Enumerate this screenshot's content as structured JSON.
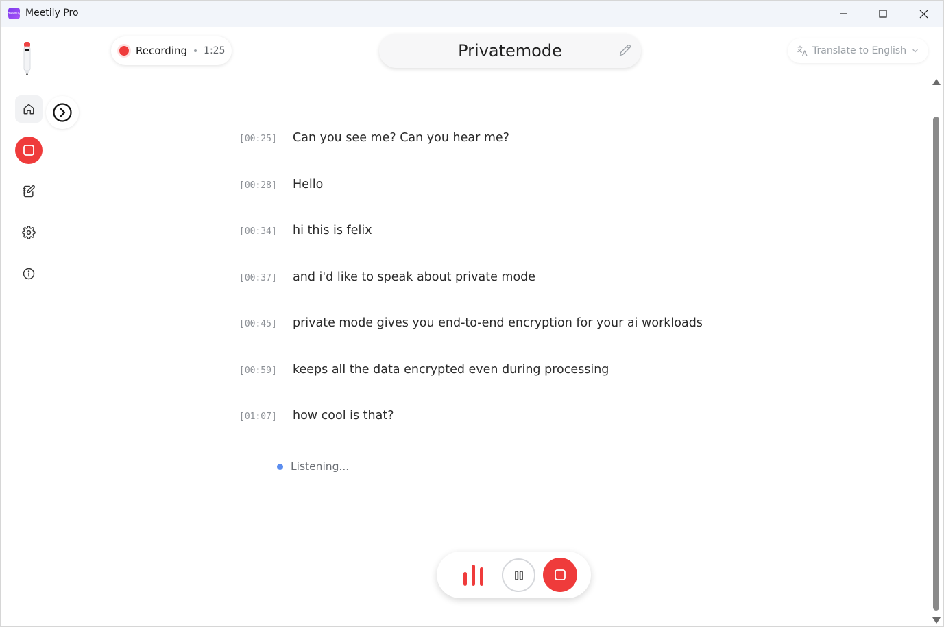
{
  "app": {
    "title": "Meetily Pro",
    "icon_text": "meetily"
  },
  "window_controls": {
    "minimize_icon": "minimize-icon",
    "maximize_icon": "maximize-icon",
    "close_icon": "close-icon"
  },
  "sidebar": {
    "items": [
      {
        "name": "home",
        "icon": "home-icon"
      },
      {
        "name": "record",
        "icon": "stop-square-icon"
      },
      {
        "name": "notes",
        "icon": "notebook-edit-icon"
      },
      {
        "name": "settings",
        "icon": "gear-icon"
      },
      {
        "name": "info",
        "icon": "info-icon"
      }
    ],
    "collapse_icon": "chevron-right-circle-icon"
  },
  "header": {
    "recording_label": "Recording",
    "recording_time": "1:25",
    "meeting_title": "Privatemode",
    "translate_label": "Translate to English"
  },
  "transcript": [
    {
      "time": "[00:25]",
      "text": "Can you see me? Can you hear me?"
    },
    {
      "time": "[00:28]",
      "text": "Hello"
    },
    {
      "time": "[00:34]",
      "text": "hi this is felix"
    },
    {
      "time": "[00:37]",
      "text": "and i'd like to speak about private mode"
    },
    {
      "time": "[00:45]",
      "text": "private mode gives you end-to-end encryption for your ai workloads"
    },
    {
      "time": "[00:59]",
      "text": "keeps all the data encrypted even during processing"
    },
    {
      "time": "[01:07]",
      "text": "how cool is that?"
    }
  ],
  "status": {
    "listening_text": "Listening..."
  },
  "colors": {
    "accent_red": "#ef3b3b",
    "listening_blue": "#5b8def",
    "titlebar_bg": "#f2f5fa"
  }
}
